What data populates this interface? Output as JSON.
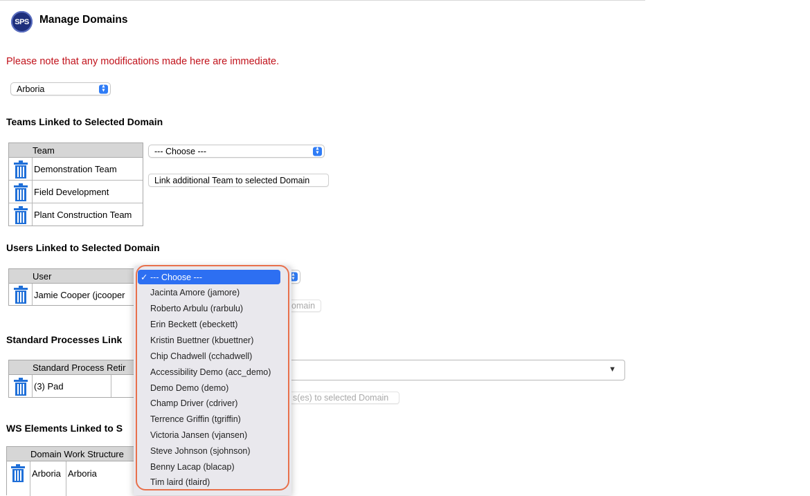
{
  "header": {
    "logo_text": "SPS",
    "title": "Manage Domains"
  },
  "notice": "Please note that any modifications made here are immediate.",
  "domain_select": {
    "value": "Arboria"
  },
  "teams": {
    "title": "Teams Linked to Selected Domain",
    "column": "Team",
    "rows": [
      "Demonstration Team",
      "Field Development",
      "Plant Construction Team"
    ],
    "choose_value": "--- Choose ---",
    "link_button": "Link additional Team to selected Domain"
  },
  "users": {
    "title": "Users Linked to Selected Domain",
    "column": "User",
    "rows": [
      "Jamie Cooper (jcooper"
    ],
    "link_button_visible_tail": "omain"
  },
  "processes": {
    "title_visible": "Standard Processes Link",
    "column_visible": "Standard Process Retir",
    "rows": [
      "(3) Pad"
    ],
    "link_button_visible_tail": "s(es) to selected Domain",
    "dropdown_arrow": "▼"
  },
  "ws_elements": {
    "title_visible": "WS Elements Linked to S",
    "column_visible": "Domain Work Structure",
    "rows": [
      {
        "col1": "Arboria",
        "col2": "Arboria"
      }
    ]
  },
  "user_dropdown": {
    "selected": "--- Choose ---",
    "check": "✓",
    "options": [
      "Jacinta Amore (jamore)",
      "Roberto Arbulu (rarbulu)",
      "Erin Beckett (ebeckett)",
      "Kristin Buettner (kbuettner)",
      "Chip Chadwell (cchadwell)",
      "Accessibility Demo (acc_demo)",
      "Demo Demo (demo)",
      "Champ Driver (cdriver)",
      "Terrence Griffin (tgriffin)",
      "Victoria Jansen (vjansen)",
      "Steve Johnson (sjohnson)",
      "Benny Lacap (blacap)",
      "Tim laird (tlaird)"
    ]
  },
  "icons": {
    "delete": "trash-icon",
    "stepper": "stepper-arrows-icon"
  },
  "colors": {
    "notice": "#c1121b",
    "accent": "#2d6ff2",
    "trash": "#1f6fd8",
    "highlight": "#e8704b"
  }
}
